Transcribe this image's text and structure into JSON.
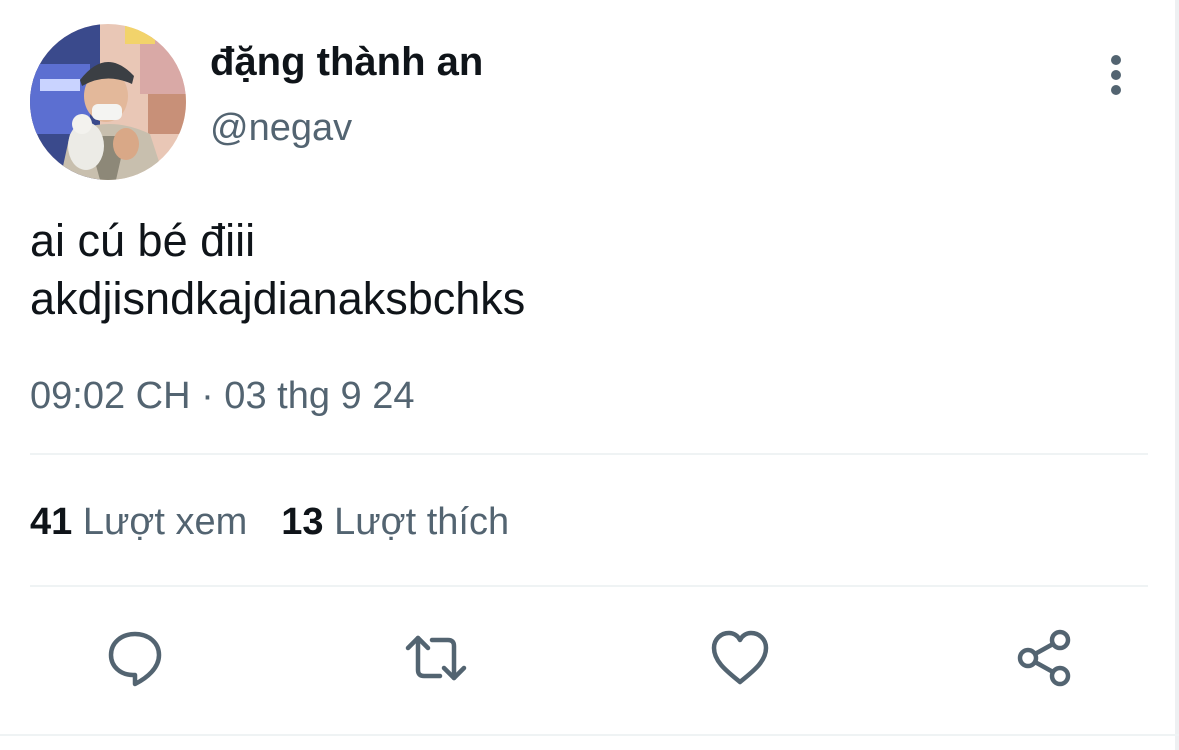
{
  "tweet": {
    "author": {
      "display_name": "đặng thành an",
      "handle": "@negav",
      "avatar_icon": "profile-photo"
    },
    "text_lines": [
      "ai cú bé điii",
      "akdjisndkajdianaksbchks"
    ],
    "timestamp": "09:02 CH · 03 thg 9 24",
    "stats": {
      "views_count": "41",
      "views_label": "Lượt xem",
      "likes_count": "13",
      "likes_label": "Lượt thích"
    }
  },
  "actions": {
    "more_icon": "more-vertical-icon",
    "reply_icon": "reply-icon",
    "retweet_icon": "retweet-icon",
    "like_icon": "heart-icon",
    "share_icon": "share-icon"
  },
  "colors": {
    "primary_text": "#0f1419",
    "secondary_text": "#536471",
    "divider": "#eff3f4",
    "icon": "#536471"
  }
}
